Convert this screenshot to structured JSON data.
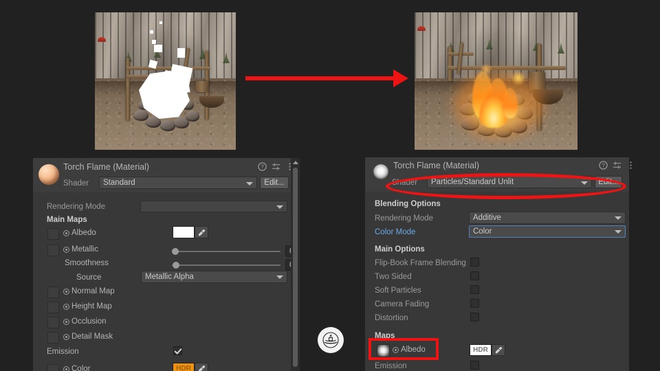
{
  "background_color": "#212121",
  "annotation": {
    "arrow_color": "#ee1414",
    "highlight_color": "#ee1414",
    "arrow_name": "red-arrow-before-after"
  },
  "screenshots": {
    "before": {
      "caption": "Campfire scene with white untextured particle quads",
      "name": "before-screenshot"
    },
    "after": {
      "caption": "Campfire scene with correctly rendered orange flame particles",
      "name": "after-screenshot"
    }
  },
  "center_badge": {
    "icon": "campfire-bowl-icon",
    "color": "#f2f2f2"
  },
  "left_panel": {
    "title": "Torch Flame (Material)",
    "preview_icon": "material-sphere-preview",
    "header_icons": [
      "help-icon",
      "preset-icon",
      "more-menu-icon"
    ],
    "shader_label": "Shader",
    "shader_value": "Standard",
    "edit_button": "Edit...",
    "rendering_mode_label": "Rendering Mode",
    "rendering_mode_value": "",
    "section_main_maps": "Main Maps",
    "rows": [
      {
        "label": "Albedo",
        "type": "texture_color",
        "swatch": "#ffffff",
        "swatch_text": ""
      },
      {
        "label": "Metallic",
        "type": "slider",
        "value": "0"
      },
      {
        "label": "Smoothness",
        "type": "slider",
        "value": "0"
      },
      {
        "label": "Source",
        "type": "dropdown",
        "value": "Metallic Alpha"
      },
      {
        "label": "Normal Map",
        "type": "texture"
      },
      {
        "label": "Height Map",
        "type": "texture"
      },
      {
        "label": "Occlusion",
        "type": "texture"
      },
      {
        "label": "Detail Mask",
        "type": "texture"
      },
      {
        "label": "Emission",
        "type": "checkbox",
        "checked": true
      },
      {
        "label": "Color",
        "type": "texture_color",
        "swatch": "#f0920f",
        "swatch_text": "HDR"
      }
    ]
  },
  "right_panel": {
    "title": "Torch Flame (Material)",
    "preview_icon": "particle-sprite-preview",
    "header_icons": [
      "help-icon",
      "preset-icon",
      "more-menu-icon"
    ],
    "shader_label": "Shader",
    "shader_value": "Particles/Standard Unlit",
    "edit_button": "Edit...",
    "section_blending": "Blending Options",
    "rendering_mode_label": "Rendering Mode",
    "rendering_mode_value": "Additive",
    "color_mode_label": "Color Mode",
    "color_mode_value": "Color",
    "section_main_options": "Main Options",
    "options": [
      {
        "label": "Flip-Book Frame Blending",
        "checked": false
      },
      {
        "label": "Two Sided",
        "checked": false
      },
      {
        "label": "Soft Particles",
        "checked": false
      },
      {
        "label": "Camera Fading",
        "checked": false
      },
      {
        "label": "Distortion",
        "checked": false
      }
    ],
    "section_maps": "Maps",
    "albedo_label": "Albedo",
    "albedo_swatch_text": "HDR",
    "albedo_swatch_color": "#ffffff",
    "emission_label": "Emission",
    "emission_checked": false
  }
}
